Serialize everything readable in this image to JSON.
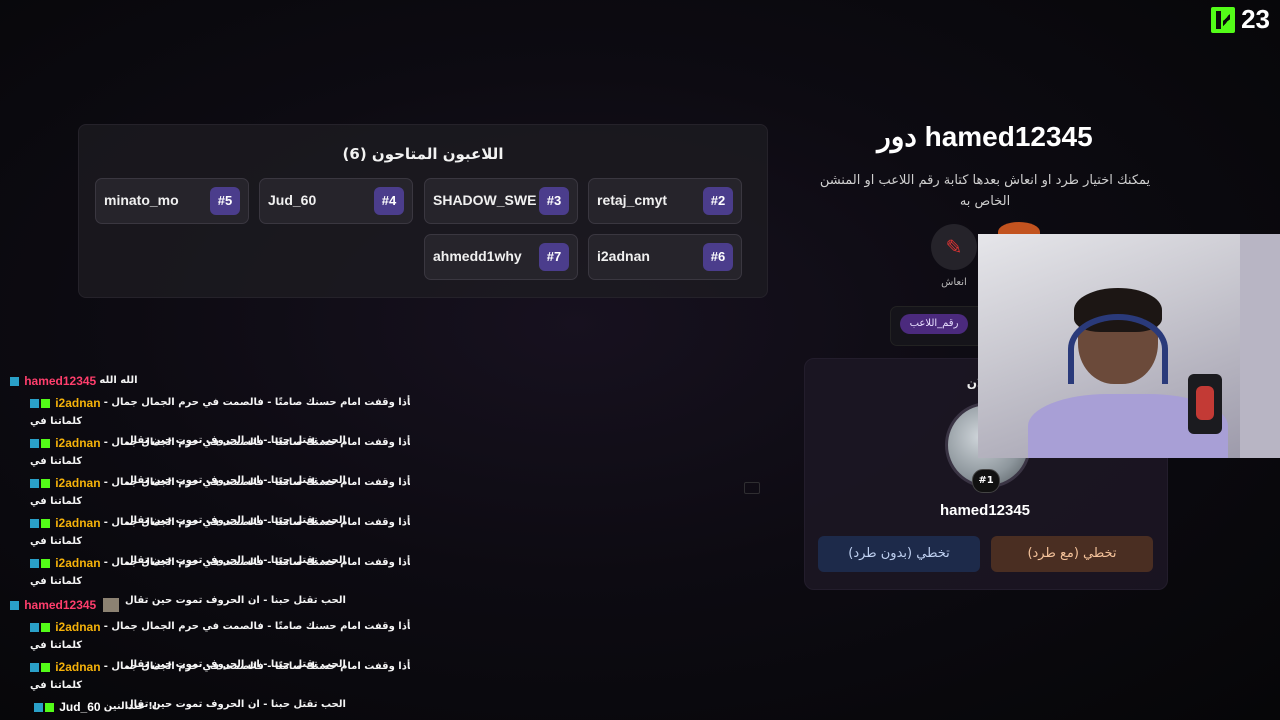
{
  "brand": {
    "count": "23",
    "accent": "#53fc18"
  },
  "players_panel": {
    "title": "اللاعبون المتاحون (6)",
    "players": [
      {
        "name": "minato_mo",
        "num": "#5"
      },
      {
        "name": "Jud_60",
        "num": "#4"
      },
      {
        "name": "SHADOW_SWE",
        "num": "#3"
      },
      {
        "name": "retaj_cmyt",
        "num": "#2"
      },
      {
        "name": "ahmedd1why",
        "num": "#7"
      },
      {
        "name": "i2adnan",
        "num": "#6"
      }
    ]
  },
  "turn": {
    "title": "دور hamed12345",
    "hint": "يمكنك اختيار طرد او انعاش بعدها كتابة رقم اللاعب او المنشن الخاص به",
    "revive_label": "انعاش",
    "hash_chip": "رقم_اللاعب"
  },
  "current": {
    "now_label": "الان",
    "rank": "#1",
    "name": "hamed12345",
    "skip_no_kick": "تخطي (بدون طرد)",
    "skip_with_kick": "تخطي (مع طرد)"
  },
  "chat": {
    "messages": [
      {
        "user": "hamed12345",
        "text": "الله الله",
        "line2": "",
        "type": "ham"
      },
      {
        "user": "i2adnan",
        "text": "فأذا وقفت امام حسنك صامتًا - فالصمت في حرم الجمال جمال - كلماتنا في",
        "line2": "الحب تقتل حبنا - ان الحروف تموت حين تقال",
        "type": "i2"
      },
      {
        "user": "i2adnan",
        "text": "فأذا وقفت امام حسنك صامتًا - فالصمت في حرم الجمال جمال - كلماتنا في",
        "line2": "الحب تقتل حبنا - ان الحروف تموت حين تقال",
        "type": "i2"
      },
      {
        "user": "i2adnan",
        "text": "فأذا وقفت امام حسنك صامتًا - فالصمت في حرم الجمال جمال - كلماتنا في",
        "line2": "الحب تقتل حبنا - ان الحروف تموت حين تقال",
        "type": "i2"
      },
      {
        "user": "i2adnan",
        "text": "فأذا وقفت امام حسنك صامتًا - فالصمت في حرم الجمال جمال - كلماتنا في",
        "line2": "الحب تقتل حبنا - ان الحروف تموت حين تقال",
        "type": "i2"
      },
      {
        "user": "i2adnan",
        "text": "فأذا وقفت امام حسنك صامتًا - فالصمت في حرم الجمال جمال - كلماتنا في",
        "line2": "الحب تقتل حبنا - ان الحروف تموت حين تقال",
        "type": "i2"
      },
      {
        "user": "hamed12345",
        "text": "",
        "line2": "",
        "type": "ham"
      },
      {
        "user": "i2adnan",
        "text": "فأذا وقفت امام حسنك صامتًا - فالصمت في حرم الجمال جمال - كلماتنا في",
        "line2": "الحب تقتل حبنا - ان الحروف تموت حين تقال",
        "type": "i2"
      },
      {
        "user": "i2adnan",
        "text": "فأذا وقفت امام حسنك صامتًا - فالصمت في حرم الجمال جمال - كلماتنا في",
        "line2": "الحب تقتل حبنا - ان الحروف تموت حين تقال",
        "type": "i2"
      },
      {
        "user": "Jud_60",
        "text": "عندالنين !!",
        "line2": "",
        "type": "jud"
      }
    ]
  }
}
